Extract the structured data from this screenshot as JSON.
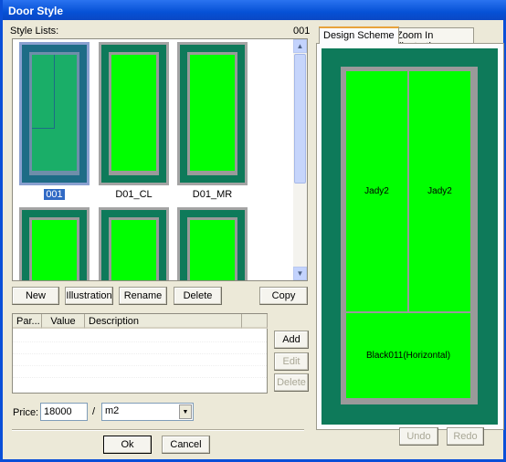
{
  "title": "Door Style",
  "style_lists_label": "Style Lists:",
  "current_style": "001",
  "styles": [
    {
      "name": "001",
      "selected": true
    },
    {
      "name": "D01_CL"
    },
    {
      "name": "D01_MR"
    },
    {
      "name": ""
    },
    {
      "name": ""
    },
    {
      "name": ""
    }
  ],
  "buttons": {
    "new": "New",
    "illustration": "Illustration",
    "rename": "Rename",
    "delete": "Delete",
    "copy": "Copy",
    "add": "Add",
    "edit": "Edit",
    "delete2": "Delete",
    "ok": "Ok",
    "cancel": "Cancel",
    "undo": "Undo",
    "redo": "Redo"
  },
  "table": {
    "columns": [
      "Par...",
      "Value",
      "Description",
      ""
    ],
    "rows": []
  },
  "price": {
    "label": "Price:",
    "value": "18000",
    "sep": "/",
    "unit": "m2"
  },
  "tabs": [
    {
      "label": "Design Scheme",
      "active": true
    },
    {
      "label": "Zoom In Illustration"
    }
  ],
  "design": {
    "cells": [
      "Jady2",
      "Jady2",
      "Black011(Horizontal)"
    ]
  },
  "colors": {
    "frame": "#0e7a5a",
    "panel": "#00ff00",
    "selection": "#316ac5"
  }
}
